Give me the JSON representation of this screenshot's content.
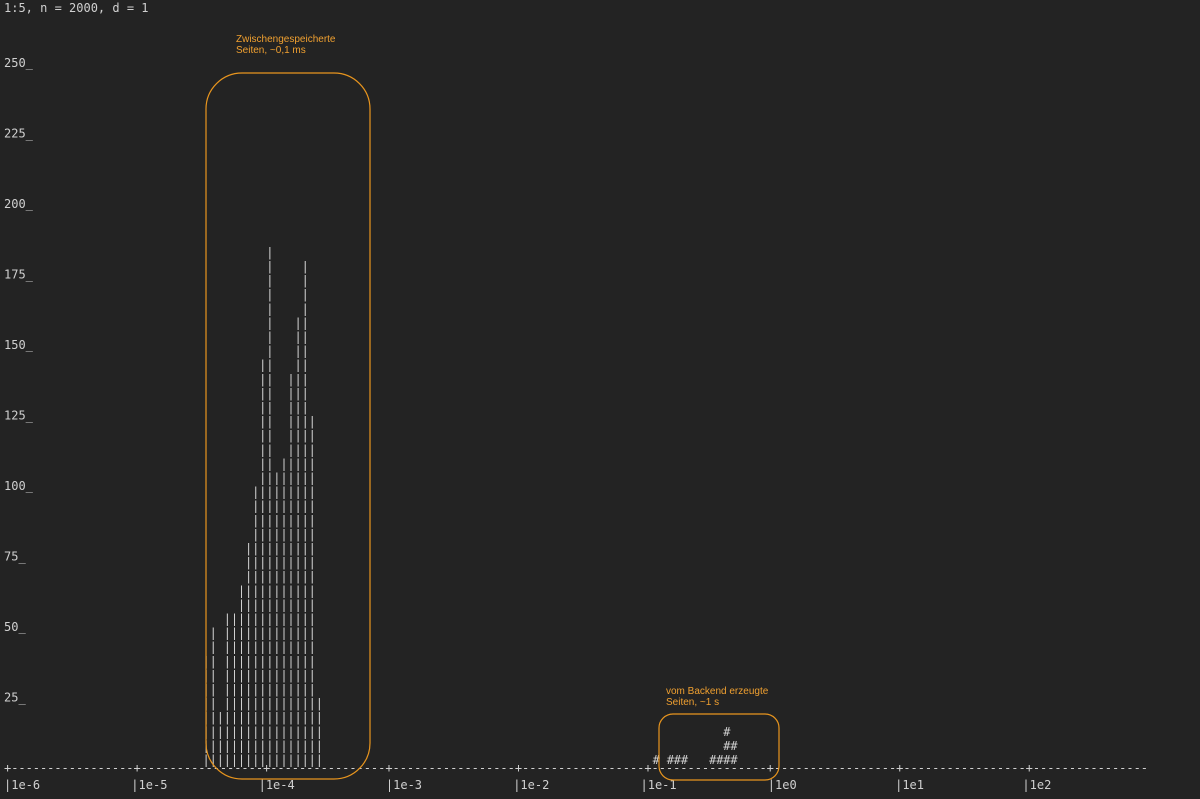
{
  "header": "1:5, n = 2000, d = 1",
  "colors": {
    "background": "#232323",
    "text": "#d0d0d0",
    "annotation": "#f0a030",
    "highlight": "#e8951e"
  },
  "chart_data": {
    "type": "bar",
    "subtitle": "1:5, n = 2000, d = 1",
    "x_scale": "log",
    "x_range": [
      1e-06,
      1000
    ],
    "xticks": [
      "|1e-6",
      "|1e-5",
      "|1e-4",
      "|1e-3",
      "|1e-2",
      "|1e-1",
      "|1e0",
      "|1e1",
      "|1e2"
    ],
    "y_range": [
      0,
      250
    ],
    "yticks": [
      "25_",
      "50_",
      "75_",
      "100_",
      "125_",
      "150_",
      "175_",
      "200_",
      "225_",
      "250_"
    ],
    "series": [
      {
        "glyph": "|",
        "columns_per_decade": 18,
        "x_start": 3.5e-05,
        "values": [
          40,
          50,
          20,
          55,
          55,
          65,
          80,
          100,
          145,
          185,
          105,
          110,
          140,
          160,
          180,
          125,
          25
        ]
      },
      {
        "glyph": "#",
        "columns_per_decade": 18,
        "x_start": 0.12,
        "values": [
          5,
          0,
          5,
          5,
          5,
          0,
          0,
          0,
          5,
          5,
          15,
          10
        ]
      }
    ],
    "annotations": [
      {
        "text": "Zwischengespeicherte\nSeiten, ~0,1 ms"
      },
      {
        "text": "vom Backend erzeugte\nSeiten, ~1 s"
      }
    ],
    "grid": false,
    "legend": "none"
  }
}
